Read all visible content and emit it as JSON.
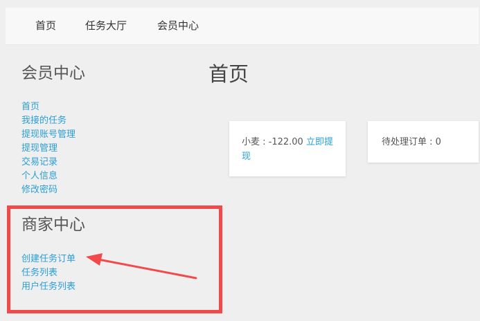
{
  "nav": {
    "items": [
      "首页",
      "任务大厅",
      "会员中心"
    ]
  },
  "sidebar": {
    "member_heading": "会员中心",
    "member_links": [
      "首页",
      "我接的任务",
      "提现账号管理",
      "提现管理",
      "交易记录",
      "个人信息",
      "修改密码"
    ],
    "merchant_heading": "商家中心",
    "merchant_links": [
      "创建任务订单",
      "任务列表",
      "用户任务列表"
    ]
  },
  "main": {
    "title": "首页",
    "balance_card": {
      "label": "小麦 : -122.00",
      "withdraw_link": "立即提现"
    },
    "pending_card": {
      "label": "待处理订单 : 0"
    }
  },
  "colors": {
    "link": "#2a9fd6",
    "annotation": "#f24a4a",
    "background": "#efefef"
  }
}
